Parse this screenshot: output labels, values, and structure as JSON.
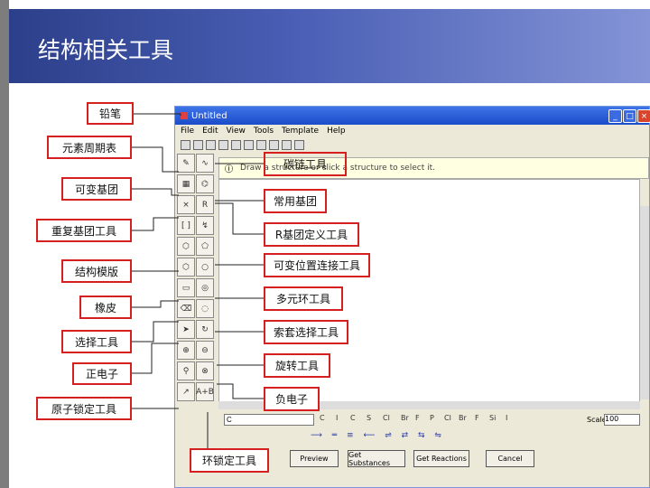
{
  "slide": {
    "title": "结构相关工具"
  },
  "window": {
    "title": "Untitled",
    "menus": [
      "File",
      "Edit",
      "View",
      "Tools",
      "Template",
      "Help"
    ],
    "info_text": "Draw a structure or click a structure to select it.",
    "formula_value": "C",
    "formula_buttons": [
      "C",
      "I",
      "C",
      "S",
      "Cl",
      "Br",
      "F",
      "P",
      "Cl",
      "Br",
      "F",
      "Si",
      "I"
    ],
    "scale_label": "Scale",
    "scale_value": "100",
    "arrow_row": "⟶ ═ ≡ ⟵ ⇌ ⇄ ⇆ ⇋",
    "buttons": [
      "Preview",
      "Get Substances",
      "Get Reactions",
      "Cancel"
    ]
  },
  "callouts": {
    "pencil": "铅笔",
    "periodic_table": "元素周期表",
    "variable_group": "可变基团",
    "repeat_group": "重复基团工具",
    "template": "结构模版",
    "eraser": "橡皮",
    "select": "选择工具",
    "positive": "正电子",
    "atom_lock": "原子锁定工具",
    "carbon_chain": "碳链工具",
    "common_group": "常用基团",
    "r_group": "R基团定义工具",
    "variable_position": "可变位置连接工具",
    "multi_ring": "多元环工具",
    "lasso": "索套选择工具",
    "rotate": "旋转工具",
    "negative": "负电子",
    "ring_lock": "环锁定工具"
  },
  "colors": {
    "banner": "#3a4fa8",
    "callout_border": "#d62020",
    "window_title": "#2a5fd8"
  }
}
